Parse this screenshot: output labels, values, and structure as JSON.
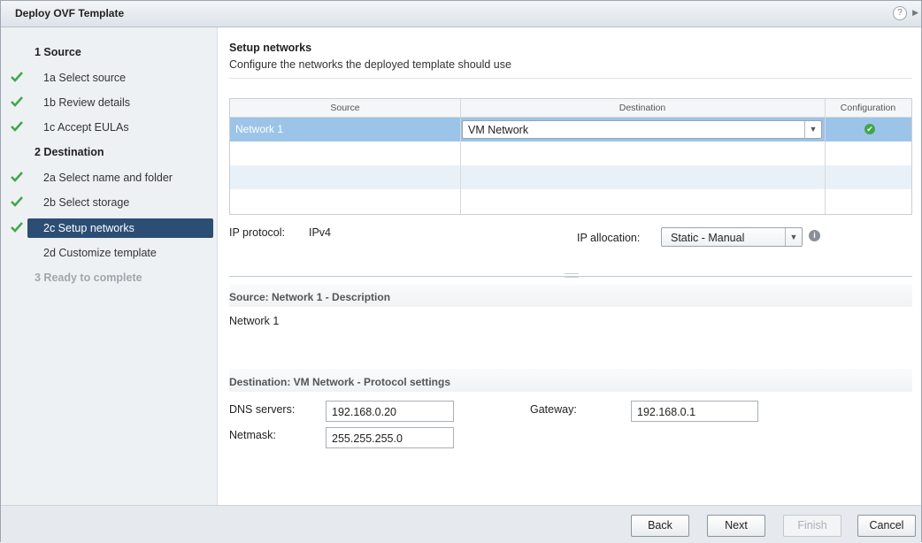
{
  "window": {
    "title": "Deploy OVF Template",
    "help_symbol": "?",
    "more_symbol": "▶"
  },
  "nav": {
    "source_header": "1 Source",
    "select_source": "1a Select source",
    "review_details": "1b Review details",
    "accept_eulas": "1c Accept EULAs",
    "destination_header": "2 Destination",
    "select_name_folder": "2a Select name and folder",
    "select_storage": "2b Select storage",
    "setup_networks": "2c Setup networks",
    "customize_template": "2d Customize template",
    "ready_to_complete": "3 Ready to complete"
  },
  "page": {
    "title": "Setup networks",
    "subtitle": "Configure the networks the deployed template should use"
  },
  "grid": {
    "columns": [
      "Source",
      "Destination",
      "Configuration"
    ],
    "rows": [
      {
        "source": "Network 1",
        "destination": "VM Network",
        "status": "ok"
      }
    ]
  },
  "ip": {
    "protocol_label": "IP protocol:",
    "protocol_value": "IPv4",
    "allocation_label": "IP allocation:",
    "allocation_value": "Static - Manual"
  },
  "description": {
    "header": "Source: Network 1 - Description",
    "text": "Network 1"
  },
  "protocol_settings": {
    "header": "Destination: VM Network - Protocol settings",
    "dns_label": "DNS servers:",
    "dns_value": "192.168.0.20",
    "gateway_label": "Gateway:",
    "gateway_value": "192.168.0.1",
    "netmask_label": "Netmask:",
    "netmask_value": "255.255.255.0"
  },
  "footer": {
    "back": "Back",
    "next": "Next",
    "finish": "Finish",
    "cancel": "Cancel"
  },
  "colors": {
    "nav_active": "#2c4e74",
    "selected_row": "#9cc4e8",
    "check_green": "#3fa74a"
  }
}
